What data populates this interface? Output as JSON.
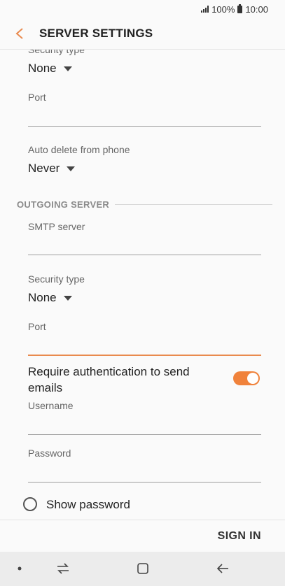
{
  "status_bar": {
    "battery": "100%",
    "time": "10:00"
  },
  "app_bar": {
    "title": "SERVER SETTINGS"
  },
  "incoming": {
    "security_type_label": "Security type",
    "security_type_value": "None",
    "port_label": "Port",
    "port_value": "",
    "auto_delete_label": "Auto delete from phone",
    "auto_delete_value": "Never"
  },
  "outgoing": {
    "section_title": "OUTGOING SERVER",
    "smtp_label": "SMTP server",
    "smtp_value": "",
    "security_type_label": "Security type",
    "security_type_value": "None",
    "port_label": "Port",
    "port_value": "",
    "require_auth_label": "Require authentication to send emails",
    "require_auth_on": true,
    "username_label": "Username",
    "username_value": "",
    "password_label": "Password",
    "password_value": "",
    "show_password_label": "Show password",
    "show_password_checked": false
  },
  "footer": {
    "sign_in_label": "SIGN IN"
  },
  "colors": {
    "accent": "#f0823b",
    "back_arrow": "#e98a4e"
  },
  "nav_bar": {
    "icons": [
      "recent-apps-dot-icon",
      "recents-icon",
      "home-icon",
      "back-icon"
    ]
  }
}
